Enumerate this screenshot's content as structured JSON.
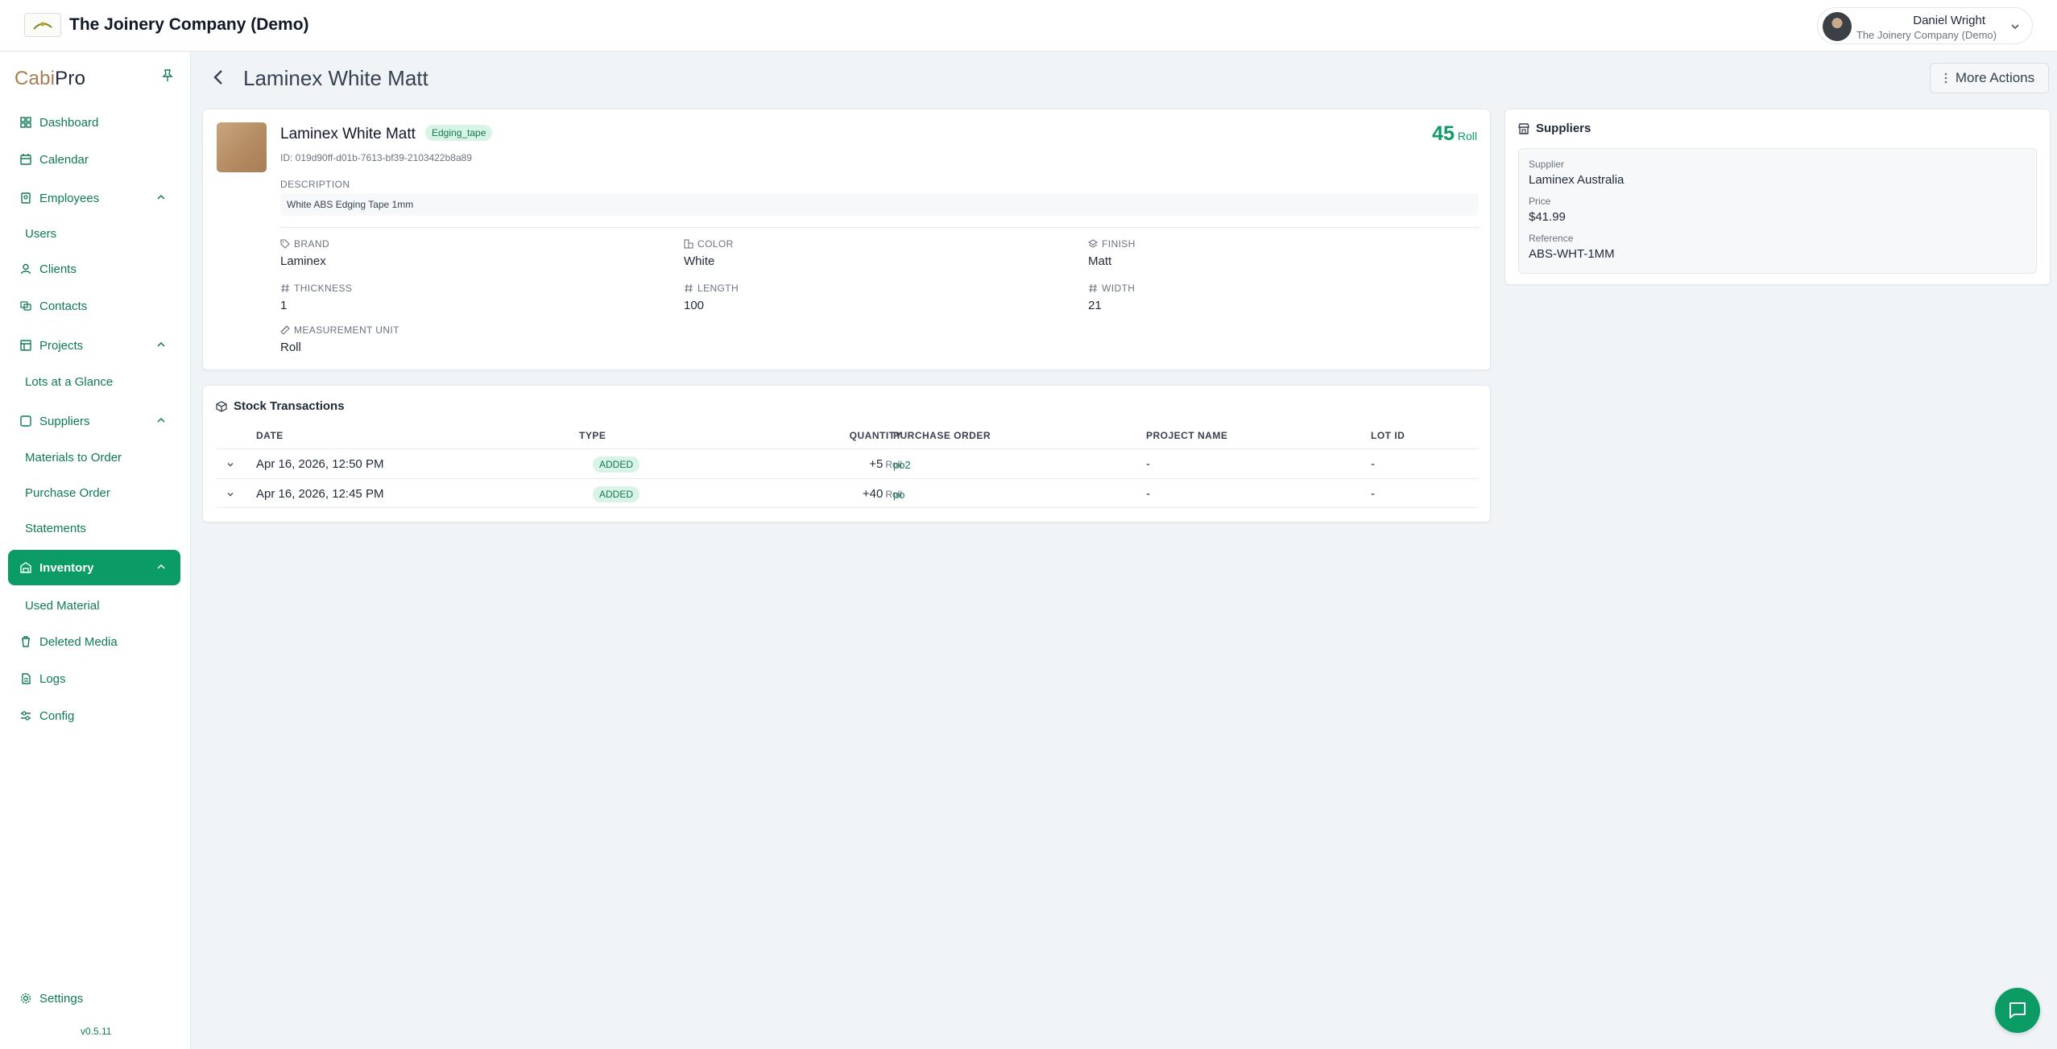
{
  "topbar": {
    "company_name": "The Joinery Company (Demo)",
    "user_name": "Daniel Wright",
    "user_company": "The Joinery Company (Demo)"
  },
  "sidebar": {
    "brand_prefix": "Cabi",
    "brand_suffix": "Pro",
    "items": [
      {
        "label": "Dashboard",
        "icon": "dashboard-icon"
      },
      {
        "label": "Calendar",
        "icon": "calendar-icon"
      },
      {
        "label": "Employees",
        "icon": "employees-icon"
      },
      {
        "label": "Users"
      },
      {
        "label": "Clients",
        "icon": "user-icon"
      },
      {
        "label": "Contacts",
        "icon": "contacts-icon"
      },
      {
        "label": "Projects",
        "icon": "projects-icon"
      },
      {
        "label": "Lots at a Glance"
      },
      {
        "label": "Suppliers",
        "icon": "suppliers-icon"
      },
      {
        "label": "Materials to Order"
      },
      {
        "label": "Purchase Order"
      },
      {
        "label": "Statements"
      },
      {
        "label": "Inventory",
        "icon": "inventory-icon"
      },
      {
        "label": "Used Material"
      },
      {
        "label": "Deleted Media",
        "icon": "trash-icon"
      },
      {
        "label": "Logs",
        "icon": "logs-icon"
      },
      {
        "label": "Config",
        "icon": "config-icon"
      }
    ],
    "settings_label": "Settings",
    "version": "v0.5.11"
  },
  "page": {
    "title": "Laminex White Matt",
    "more_actions_label": "More Actions"
  },
  "material": {
    "name": "Laminex White Matt",
    "tag": "Edging_tape",
    "id_text": "ID: 019d90ff-d01b-7613-bf39-2103422b8a89",
    "quantity": "45",
    "unit": "Roll",
    "description_label": "DESCRIPTION",
    "description": "White ABS Edging Tape 1mm",
    "attributes": {
      "brand": {
        "label": "BRAND",
        "value": "Laminex"
      },
      "color": {
        "label": "COLOR",
        "value": "White"
      },
      "finish": {
        "label": "FINISH",
        "value": "Matt"
      },
      "thickness": {
        "label": "THICKNESS",
        "value": "1"
      },
      "length": {
        "label": "LENGTH",
        "value": "100"
      },
      "width": {
        "label": "WIDTH",
        "value": "21"
      },
      "measurement_unit": {
        "label": "MEASUREMENT UNIT",
        "value": "Roll"
      }
    }
  },
  "suppliers": {
    "title": "Suppliers",
    "supplier_label": "Supplier",
    "supplier_value": "Laminex Australia",
    "price_label": "Price",
    "price_value": "$41.99",
    "reference_label": "Reference",
    "reference_value": "ABS-WHT-1MM"
  },
  "stock": {
    "title": "Stock Transactions",
    "columns": [
      "DATE",
      "TYPE",
      "QUANTITY",
      "PURCHASE ORDER",
      "PROJECT NAME",
      "LOT ID"
    ],
    "rows": [
      {
        "date": "Apr 16, 2026, 12:50 PM",
        "type": "ADDED",
        "quantity": "+5",
        "unit": "Roll",
        "purchase_order": "po2",
        "project_name": "-",
        "lot_id": "-"
      },
      {
        "date": "Apr 16, 2026, 12:45 PM",
        "type": "ADDED",
        "quantity": "+40",
        "unit": "Roll",
        "purchase_order": "po",
        "project_name": "-",
        "lot_id": "-"
      }
    ]
  },
  "colors": {
    "accent": "#0b9c66",
    "accent_text": "#0e7a55",
    "badge_bg": "#d9f3e6"
  }
}
